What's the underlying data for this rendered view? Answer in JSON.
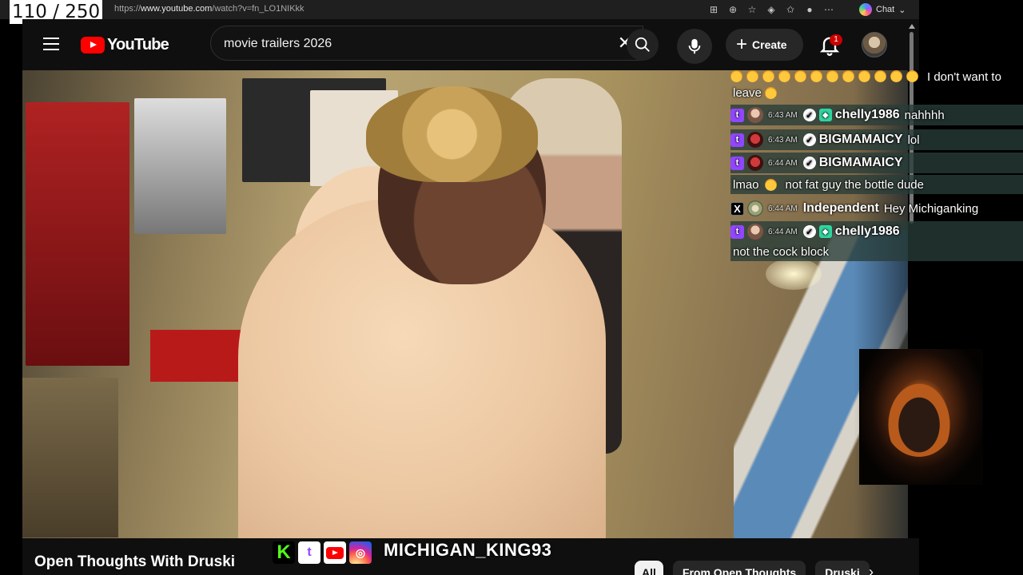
{
  "counter": "110 / 250",
  "browser": {
    "url_prefix": "https://",
    "url_domain": "www.youtube.com",
    "url_path": "/watch?v=fn_LO1NIKkk",
    "chat_label": "Chat"
  },
  "youtube": {
    "logo_text": "YouTube",
    "search_query": "movie trailers 2026",
    "create_label": "Create",
    "notification_count": "1"
  },
  "chat": {
    "messages": [
      {
        "user": "",
        "time": "",
        "text": "I don't want to"
      },
      {
        "user": "",
        "time": "",
        "text": "leave"
      },
      {
        "user": "chelly1986",
        "time": "6:43 AM",
        "text": "nahhhh"
      },
      {
        "user": "BIGMAMAICY",
        "time": "6:43 AM",
        "text": "lol"
      },
      {
        "user": "BIGMAMAICY",
        "time": "6:44 AM",
        "text": ""
      },
      {
        "user": "",
        "time": "",
        "text_before": "lmao",
        "text": "not fat guy the bottle dude"
      },
      {
        "user": "Independent",
        "time": "6:44 AM",
        "text": "Hey Michiganking"
      },
      {
        "user": "chelly1986",
        "time": "6:44 AM",
        "text": ""
      },
      {
        "user": "",
        "time": "",
        "text": "not the cock block"
      }
    ]
  },
  "bottom": {
    "video_title": "Open Thoughts With Druski",
    "streamer_name": "MICHIGAN_KING93",
    "chips": [
      "All",
      "From Open Thoughts",
      "Druski"
    ]
  }
}
